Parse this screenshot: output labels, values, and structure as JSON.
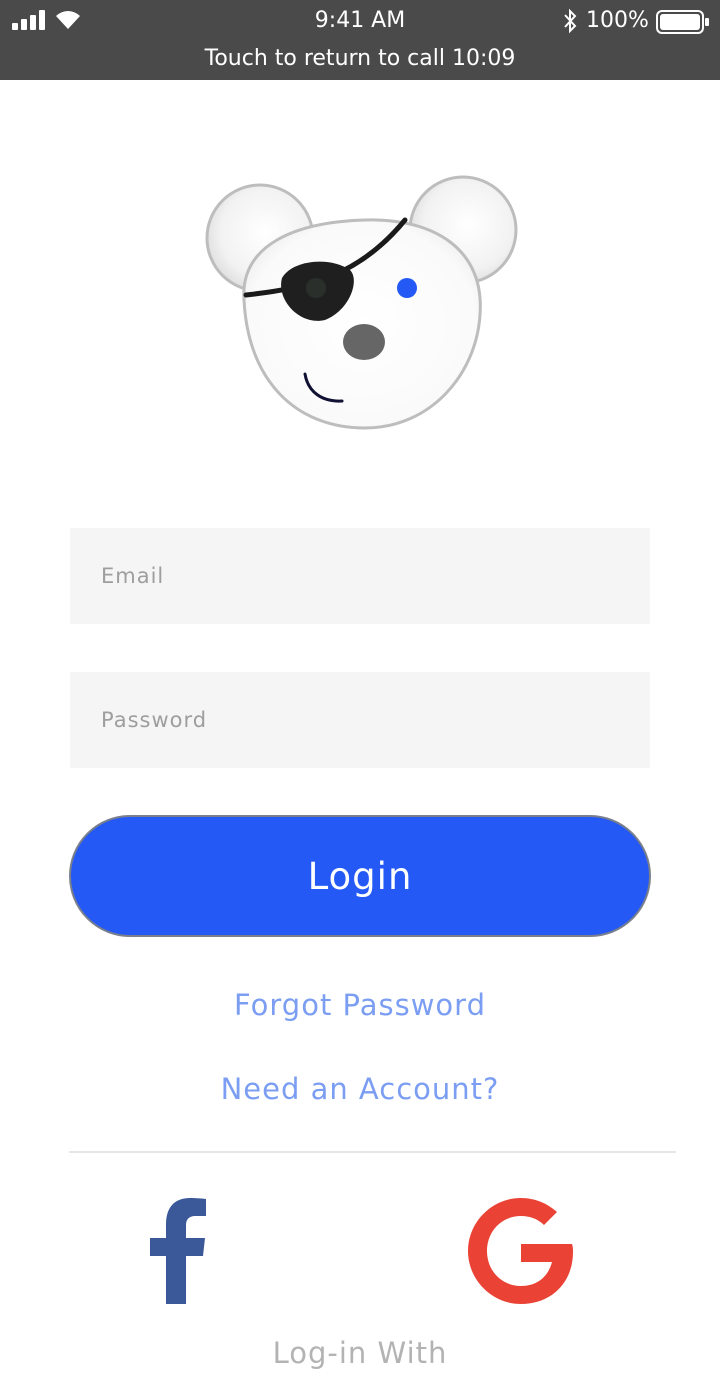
{
  "status_bar": {
    "time": "9:41 AM",
    "battery_percent": "100%",
    "call_banner": "Touch to return to call 10:09",
    "icons": [
      "signal-icon",
      "wifi-icon",
      "bluetooth-icon",
      "battery-icon"
    ]
  },
  "login_form": {
    "email_placeholder": "Email",
    "password_placeholder": "Password",
    "email_value": "",
    "password_value": "",
    "login_label": "Login",
    "forgot_password_label": "Forgot Password",
    "need_account_label": "Need an Account?"
  },
  "social": {
    "caption": "Log-in With",
    "providers": [
      "facebook-icon",
      "google-icon"
    ]
  },
  "colors": {
    "status_bar_bg": "#4a4a4a",
    "primary": "#2459f6",
    "link": "#7b9ef2",
    "field_bg": "#f5f5f5",
    "facebook": "#3b5998",
    "google": "#ea4335"
  }
}
